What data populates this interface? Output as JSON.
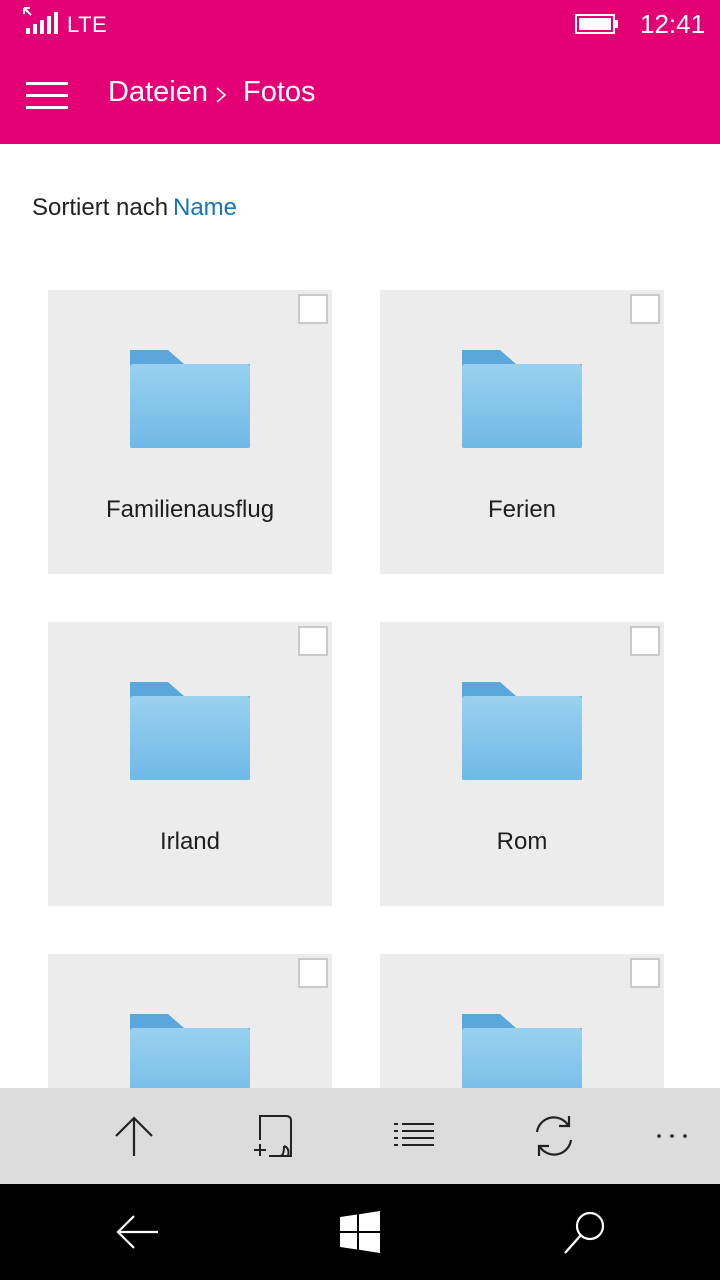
{
  "status": {
    "network": "LTE",
    "time": "12:41"
  },
  "header": {
    "breadcrumb": [
      "Dateien",
      "Fotos"
    ]
  },
  "sort": {
    "label": "Sortiert nach",
    "value": "Name"
  },
  "folders": [
    {
      "name": "Familienausflug"
    },
    {
      "name": "Ferien"
    },
    {
      "name": "Irland"
    },
    {
      "name": "Rom"
    },
    {
      "name": ""
    },
    {
      "name": ""
    }
  ],
  "colors": {
    "accent": "#e20074",
    "link": "#1a73b5",
    "folder": "#7cc0ea",
    "tile": "#ececec",
    "appbar": "#dcdcdc"
  },
  "appbar_icons": [
    "up-arrow-icon",
    "new-file-icon",
    "list-view-icon",
    "sync-icon",
    "more-icon"
  ],
  "nav_icons": [
    "back-icon",
    "windows-start-icon",
    "search-icon"
  ]
}
